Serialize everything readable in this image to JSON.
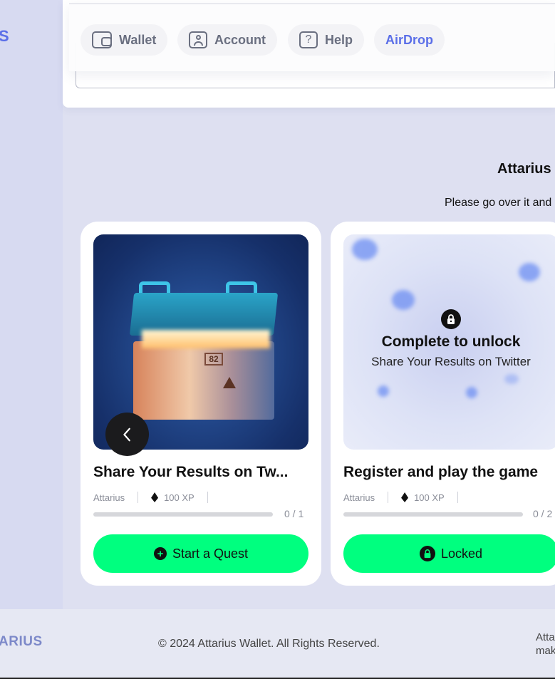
{
  "sidebar": {
    "brand_fragment": "S"
  },
  "nav": {
    "items": [
      {
        "label": "Wallet",
        "icon": "wallet-icon"
      },
      {
        "label": "Account",
        "icon": "account-icon"
      },
      {
        "label": "Help",
        "icon": "help-icon",
        "glyph": "?"
      },
      {
        "label": "AirDrop"
      }
    ],
    "active_color": "#5b6fe8"
  },
  "section": {
    "title": "Attarius",
    "subtitle": "Please go over it and"
  },
  "quests": [
    {
      "title": "Share Your Results on Tw...",
      "publisher": "Attarius",
      "reward": "100 XP",
      "progress": {
        "done": 0,
        "total": 1,
        "label": "0 / 1"
      },
      "button": {
        "label": "Start a Quest",
        "icon": "plus-circle-icon",
        "glyph": "+"
      },
      "locked": false
    },
    {
      "title": "Register and play the game",
      "publisher": "Attarius",
      "reward": "100 XP",
      "progress": {
        "done": 0,
        "total": 2,
        "label": "0 / 2"
      },
      "button": {
        "label": "Locked",
        "icon": "lock-icon"
      },
      "locked": true,
      "lock_overlay": {
        "title": "Complete to unlock",
        "subtitle": "Share Your Results on Twitter"
      }
    }
  ],
  "chest_label": "82",
  "footer": {
    "brand_fragment": "ARIUS",
    "copyright": "© 2024 Attarius Wallet. All Rights Reserved.",
    "note_line1": "Atta",
    "note_line2": "mak"
  },
  "colors": {
    "accent_green": "#00ff7f",
    "brand_blue": "#5b6fe8"
  }
}
